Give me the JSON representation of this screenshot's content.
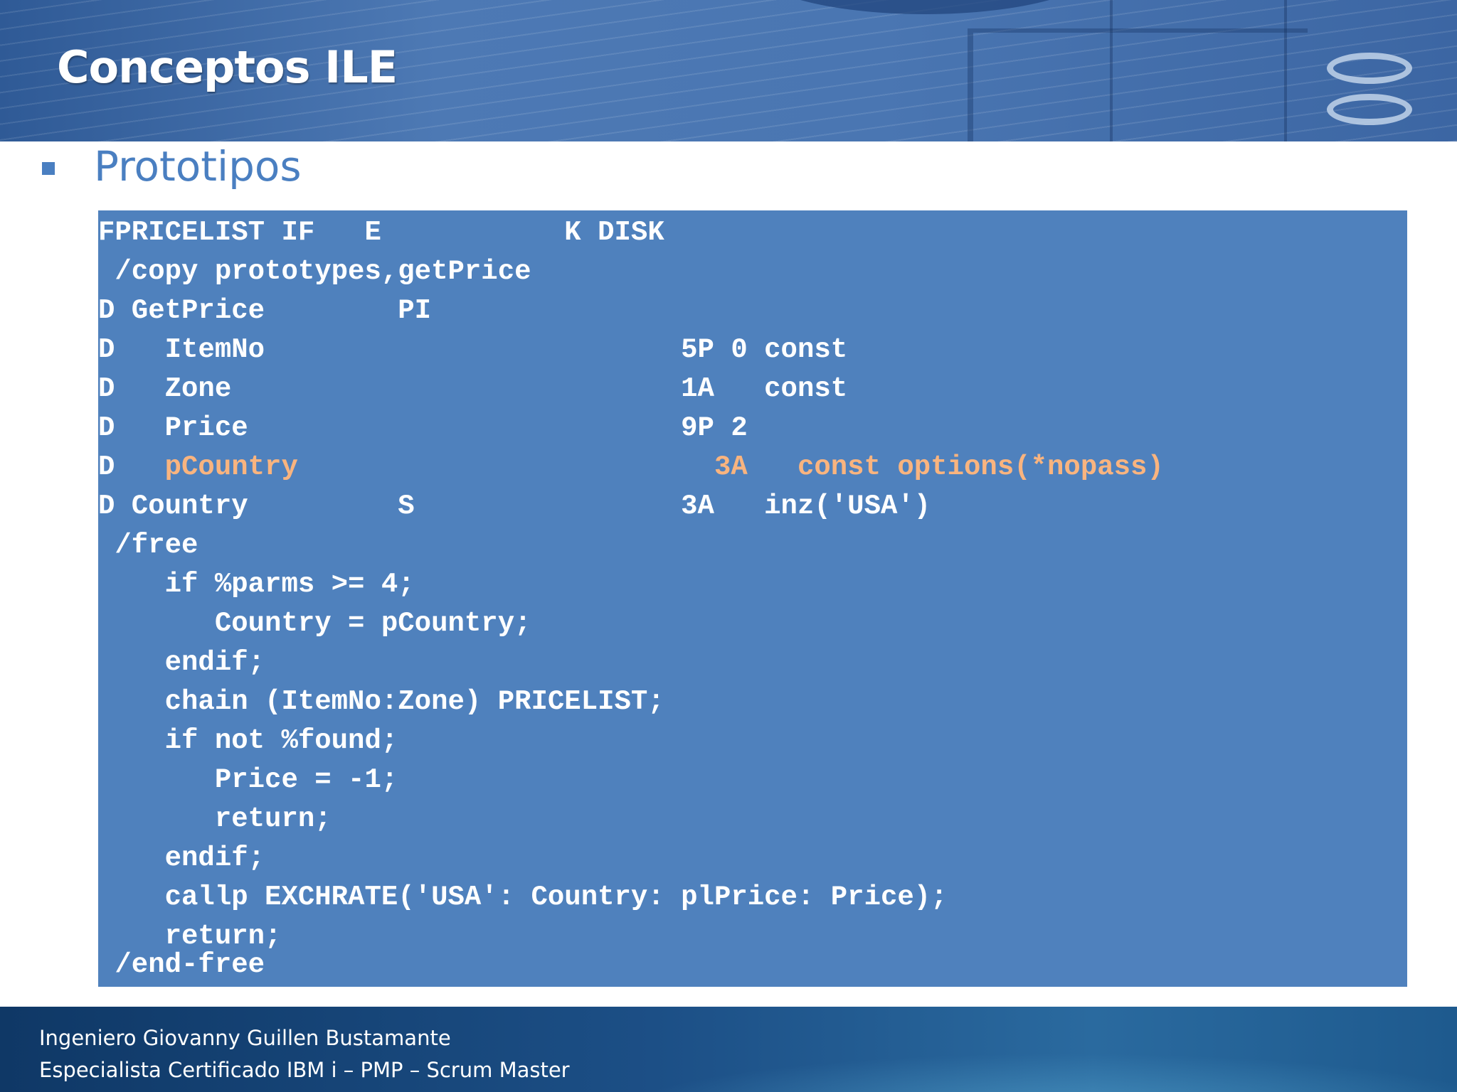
{
  "slide": {
    "title": "Conceptos ILE",
    "bullet": "Prototipos"
  },
  "code": {
    "lines": [
      {
        "text": "FPRICELIST IF   E           K DISK"
      },
      {
        "text": " /copy prototypes,getPrice"
      },
      {
        "text": "D GetPrice        PI"
      },
      {
        "text": "D   ItemNo                         5P 0 const"
      },
      {
        "text": "D   Zone                           1A   const"
      },
      {
        "text": "D   Price                          9P 2"
      },
      {
        "prefix": "D   ",
        "highlight": "pCountry                         3A   const options(*nopass)"
      },
      {
        "text": "D Country         S                3A   inz('USA')"
      },
      {
        "text": " /free"
      },
      {
        "text": "    if %parms >= 4;"
      },
      {
        "text": "       Country = pCountry;"
      },
      {
        "text": "    endif;"
      },
      {
        "text": "    chain (ItemNo:Zone) PRICELIST;"
      },
      {
        "text": "    if not %found;"
      },
      {
        "text": "       Price = -1;"
      },
      {
        "text": "       return;"
      },
      {
        "text": "    endif;"
      },
      {
        "text": "    callp EXCHRATE('USA': Country: plPrice: Price);"
      },
      {
        "text": "    return;"
      },
      {
        "text": " /end-free"
      }
    ],
    "highlight_color": "#f9b47f"
  },
  "footer": {
    "line1": "Ingeniero Giovanny Guillen Bustamante",
    "line2": "Especialista Certificado IBM i – PMP – Scrum Master"
  }
}
